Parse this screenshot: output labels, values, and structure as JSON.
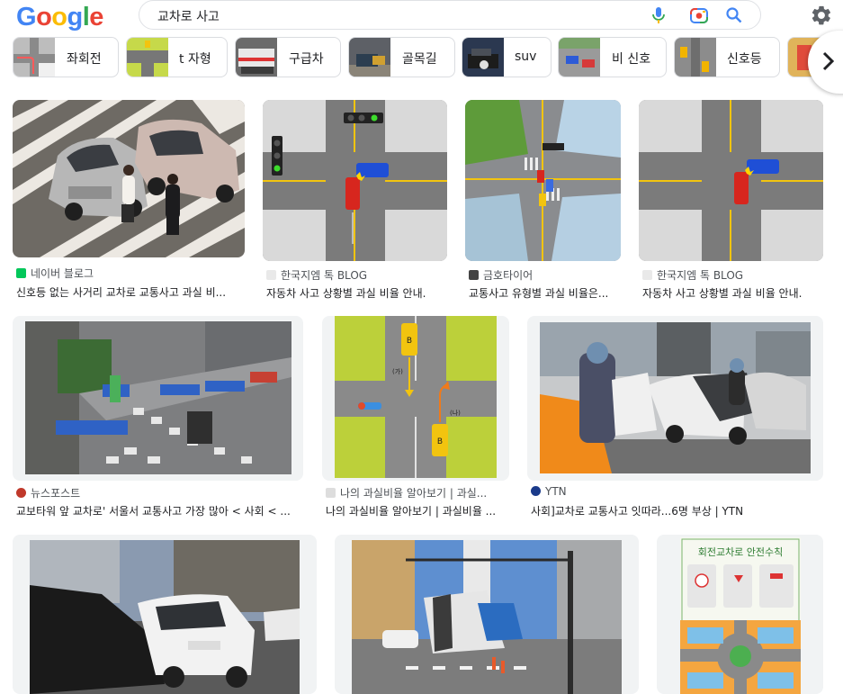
{
  "search": {
    "query": "교차로 사고"
  },
  "logo": [
    "G",
    "o",
    "o",
    "g",
    "l",
    "e"
  ],
  "chips": [
    {
      "label": "좌회전"
    },
    {
      "label": "t 자형"
    },
    {
      "label": "구급차"
    },
    {
      "label": "골목길"
    },
    {
      "label": "suv"
    },
    {
      "label": "비 신호"
    },
    {
      "label": "신호등"
    }
  ],
  "results": [
    {
      "source": "네이버 블로그",
      "caption": "신호등 없는 사거리 교차로 교통사고 과실 비..."
    },
    {
      "source": "한국지엠 톡 BLOG",
      "caption": "자동차 사고 상황별 과실 비율 안내."
    },
    {
      "source": "금호타이어",
      "caption": "교통사고 유형별 과실 비율은..."
    },
    {
      "source": "한국지엠 톡 BLOG",
      "caption": "자동차 사고 상황별 과실 비율 안내."
    },
    {
      "source": "뉴스포스트",
      "caption": "교보타워 앞 교차로' 서울서 교통사고 가장 많아 < 사회 < ..."
    },
    {
      "source": "나의 과실비율 알아보기 | 과실...",
      "caption": "나의 과실비율 알아보기 | 과실비율 ..."
    },
    {
      "source": "YTN",
      "caption": "사회]교차로 교통사고 잇따라...6명 부상 | YTN"
    }
  ],
  "poster_title": "회전교차로 안전수칙",
  "colors": {
    "accent": "#1a73e8",
    "naver": "#03c75a",
    "news": "#c0392b",
    "ytn": "#1a3a8a"
  }
}
